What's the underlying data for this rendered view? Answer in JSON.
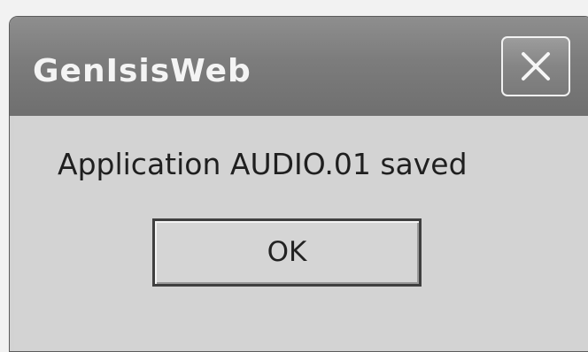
{
  "dialog": {
    "title": "GenIsisWeb",
    "close_icon": "close-icon",
    "message": "Application AUDIO.01 saved",
    "ok_label": "OK"
  }
}
